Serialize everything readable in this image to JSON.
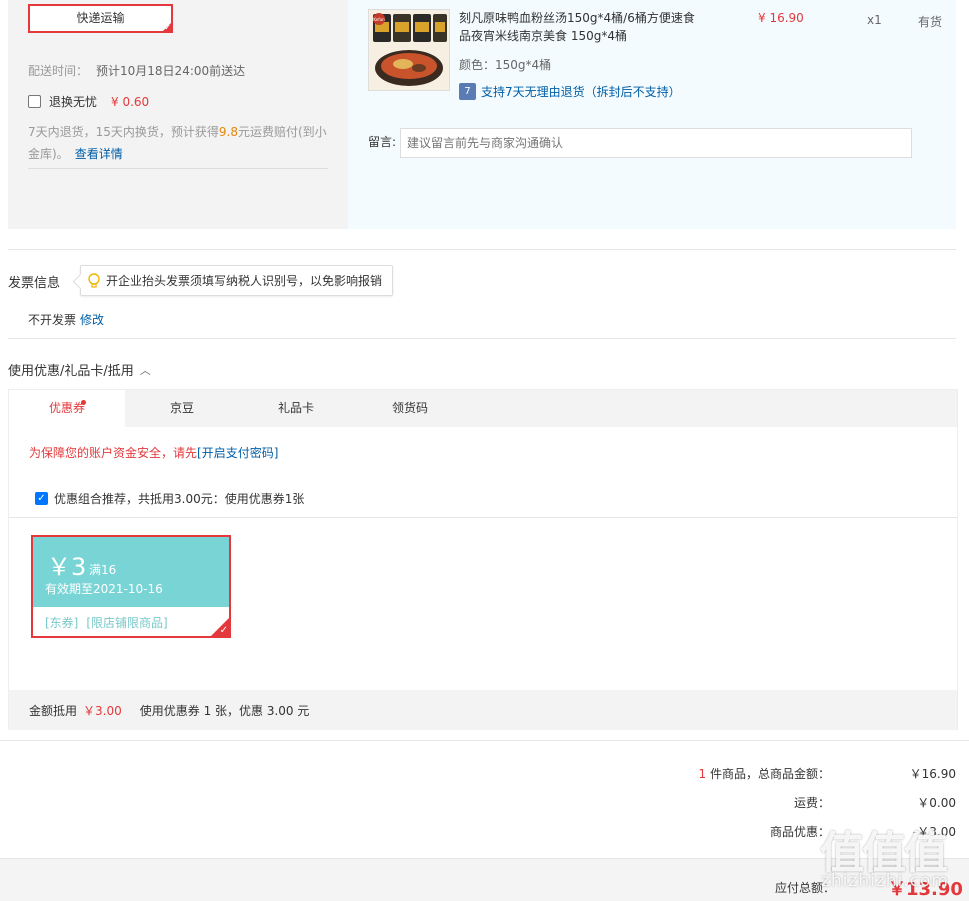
{
  "shipping": {
    "method_button": "快递运输",
    "delivery_label": "配送时间：",
    "delivery_value": "预计10月18日24:00前送达",
    "refund_option_label": "退换无忧",
    "refund_option_price": "¥ 0.60",
    "refund_desc_before": "7天内退货，15天内换货，预计获得",
    "refund_desc_amount": "9.8",
    "refund_desc_after": "元运费赔付(到小金库)。",
    "refund_detail_link": "查看详情"
  },
  "product": {
    "name": "刻凡原味鸭血粉丝汤150g*4桶/6桶方便速食品夜宵米线南京美食 150g*4桶",
    "price": "¥ 16.90",
    "quantity": "x1",
    "stock": "有货",
    "color": "颜色：150g*4桶",
    "return_icon": "7",
    "return_policy": "支持7天无理由退货（拆封后不支持）",
    "message_label": "留言:",
    "message_placeholder": "建议留言前先与商家沟通确认",
    "image_label": "Kefan"
  },
  "invoice": {
    "title": "发票信息",
    "tip": "开企业抬头发票须填写纳税人识别号，以免影响报销",
    "value": "不开发票",
    "edit_link": "修改"
  },
  "coupons": {
    "section_title": "使用优惠/礼品卡/抵用",
    "tabs": [
      {
        "label": "优惠券"
      },
      {
        "label": "京豆"
      },
      {
        "label": "礼品卡"
      },
      {
        "label": "领货码"
      }
    ],
    "warning_text": "为保障您的账户资金安全，请先",
    "warning_link": "[开启支付密码]",
    "combo_text": "优惠组合推荐，共抵用3.00元：使用优惠券1张",
    "card": {
      "amount": "￥3",
      "condition": "满16",
      "validity": "有效期至2021-10-16",
      "tag1": "[东券]",
      "tag2": "[限店铺限商品]"
    },
    "summary_label": "金额抵用",
    "summary_amount": "￥3.00",
    "summary_desc": "使用优惠券 1 张，优惠 3.00 元"
  },
  "totals": {
    "items_count": "1",
    "items_label": "件商品，总商品金额：",
    "items_value": "￥16.90",
    "shipping_label": "运费：",
    "shipping_value": "￥0.00",
    "discount_label": "商品优惠：",
    "discount_value": "-￥3.00",
    "pay_label": "应付总额：",
    "pay_value": "￥13.90"
  },
  "watermark": {
    "big": "值值值",
    "small": "zhizhizhi.com"
  },
  "colors": {
    "accent_red": "#e4393c",
    "link_blue": "#005ea7",
    "coupon_teal": "#79d4d5"
  }
}
